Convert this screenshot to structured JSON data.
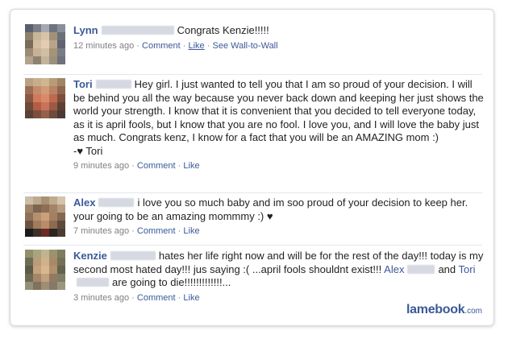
{
  "posts": [
    {
      "name": "Lynn",
      "text": "Congrats Kenzie!!!!!",
      "time": "12 minutes ago",
      "actions": [
        "Comment",
        "Like",
        "See Wall-to-Wall"
      ]
    },
    {
      "name": "Tori",
      "text": "Hey girl. I just wanted to tell you that I am so proud of your decision. I will be behind you all the way because you never back down and keeping her just shows the world your strength. I know that it is convenient that you decided to tell everyone today, as it is april fools, but I know that you are no fool. I love you, and I will love the baby just as much. Congrats kenz, I know for a fact that you will be an AMAZING mom :)",
      "sign": "-♥ Tori",
      "time": "9 minutes ago",
      "actions": [
        "Comment",
        "Like"
      ]
    },
    {
      "name": "Alex",
      "text": "i love you so much baby and im soo proud of your decision to keep her. your going to be an amazing mommmy :) ♥",
      "time": "7 minutes ago",
      "actions": [
        "Comment",
        "Like"
      ]
    },
    {
      "name": "Kenzie",
      "text_a": "hates her life right now and will be for the rest of the day!!! today is my second most hated day!!! jus saying :( ...april fools shouldnt exist!!!",
      "mention_1": "Alex",
      "text_b": "and",
      "mention_2": "Tori",
      "text_c": "are going to die!!!!!!!!!!!!!...",
      "time": "3 minutes ago",
      "actions": [
        "Comment",
        "Like"
      ]
    }
  ],
  "separator": "·",
  "brand": {
    "name": "lamebook",
    "suffix": ".com"
  }
}
